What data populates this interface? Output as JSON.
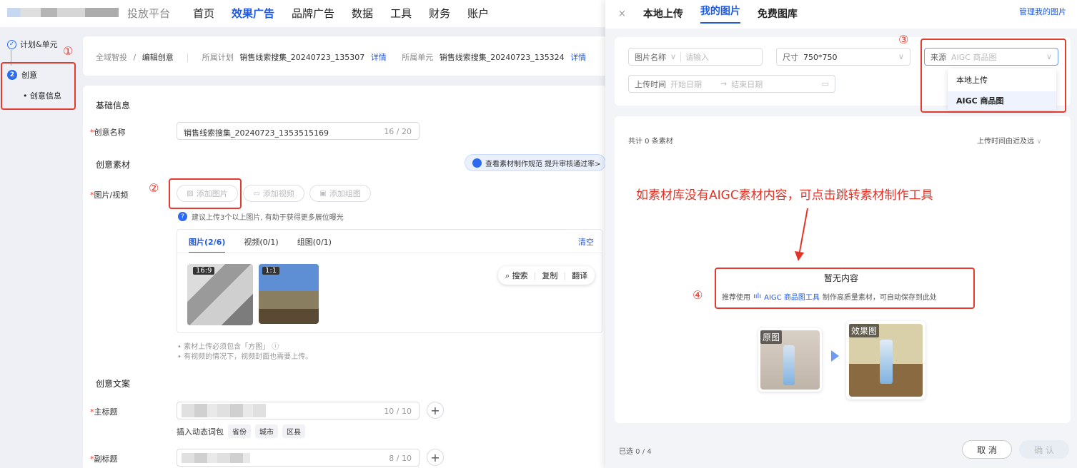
{
  "nav": {
    "brand": "投放平台",
    "items": [
      "首页",
      "效果广告",
      "品牌广告",
      "数据",
      "工具",
      "财务",
      "账户"
    ],
    "active_index": 1
  },
  "steps": {
    "step1": "计划&单元",
    "step2_num": "2",
    "step2": "创意",
    "step3": "创意信息"
  },
  "annotations": {
    "a1": "①",
    "a2": "②",
    "a3": "③",
    "a4": "④",
    "hint": "如素材库没有AIGC素材内容，可点击跳转素材制作工具"
  },
  "breadcrumb": {
    "root": "全域智投",
    "sep": "/",
    "current": "编辑创意",
    "plan_label": "所属计划",
    "plan_value": "销售线索搜集_20240723_135307",
    "plan_link": "详情",
    "unit_label": "所属单元",
    "unit_value": "销售线索搜集_20240723_135324",
    "unit_link": "详情"
  },
  "form": {
    "basic_title": "基础信息",
    "name_label": "创意名称",
    "name_value": "销售线索搜集_20240723_1353515169",
    "name_count": "16 / 20",
    "material_title": "创意素材",
    "spec_text": "查看素材制作规范 提升审核通过率>",
    "media_label": "图片/视频",
    "add_image": "添加图片",
    "add_video": "添加视频",
    "add_group": "添加组图",
    "suggest": "建议上传3个以上图片, 有助于获得更多展位曝光",
    "tabs": [
      "图片(2/6)",
      "视频(0/1)",
      "组图(0/1)"
    ],
    "clear": "清空",
    "thumbs": [
      "16:9",
      "1:1"
    ],
    "tools": [
      "搜索",
      "复制",
      "翻译"
    ],
    "note1": "素材上传必须包含「方图」",
    "note2": "有视频的情况下，视频封面也需要上传。",
    "copy_title": "创意文案",
    "main_title_label": "主标题",
    "main_title_count": "10 / 10",
    "dyn_label": "插入动态词包",
    "dyn_tags": [
      "省份",
      "城市",
      "区县"
    ],
    "sub_title_label": "副标题",
    "sub_title_count": "8 / 10"
  },
  "drawer": {
    "close": "×",
    "tabs": [
      "本地上传",
      "我的图片",
      "免费图库"
    ],
    "active_tab": 1,
    "manage": "管理我的图片",
    "filters": {
      "name_label": "图片名称",
      "name_placeholder": "请输入",
      "size_label": "尺寸",
      "size_value": "750*750",
      "source_label": "来源",
      "source_value": "AIGC 商品图",
      "time_label": "上传时间",
      "start": "开始日期",
      "arrow": "→",
      "end": "结束日期"
    },
    "source_options": [
      "本地上传",
      "AIGC 商品图"
    ],
    "count": "共计 0 条素材",
    "sort": "上传时间由近及远",
    "empty_title": "暂无内容",
    "empty_pre": "推荐使用",
    "empty_tool": "AIGC 商品图工具",
    "empty_post": "制作高质量素材，可自动保存到此处",
    "orig_label": "原图",
    "result_label": "效果图",
    "selected": "已选 0 / 4",
    "cancel": "取 消",
    "confirm": "确 认"
  }
}
